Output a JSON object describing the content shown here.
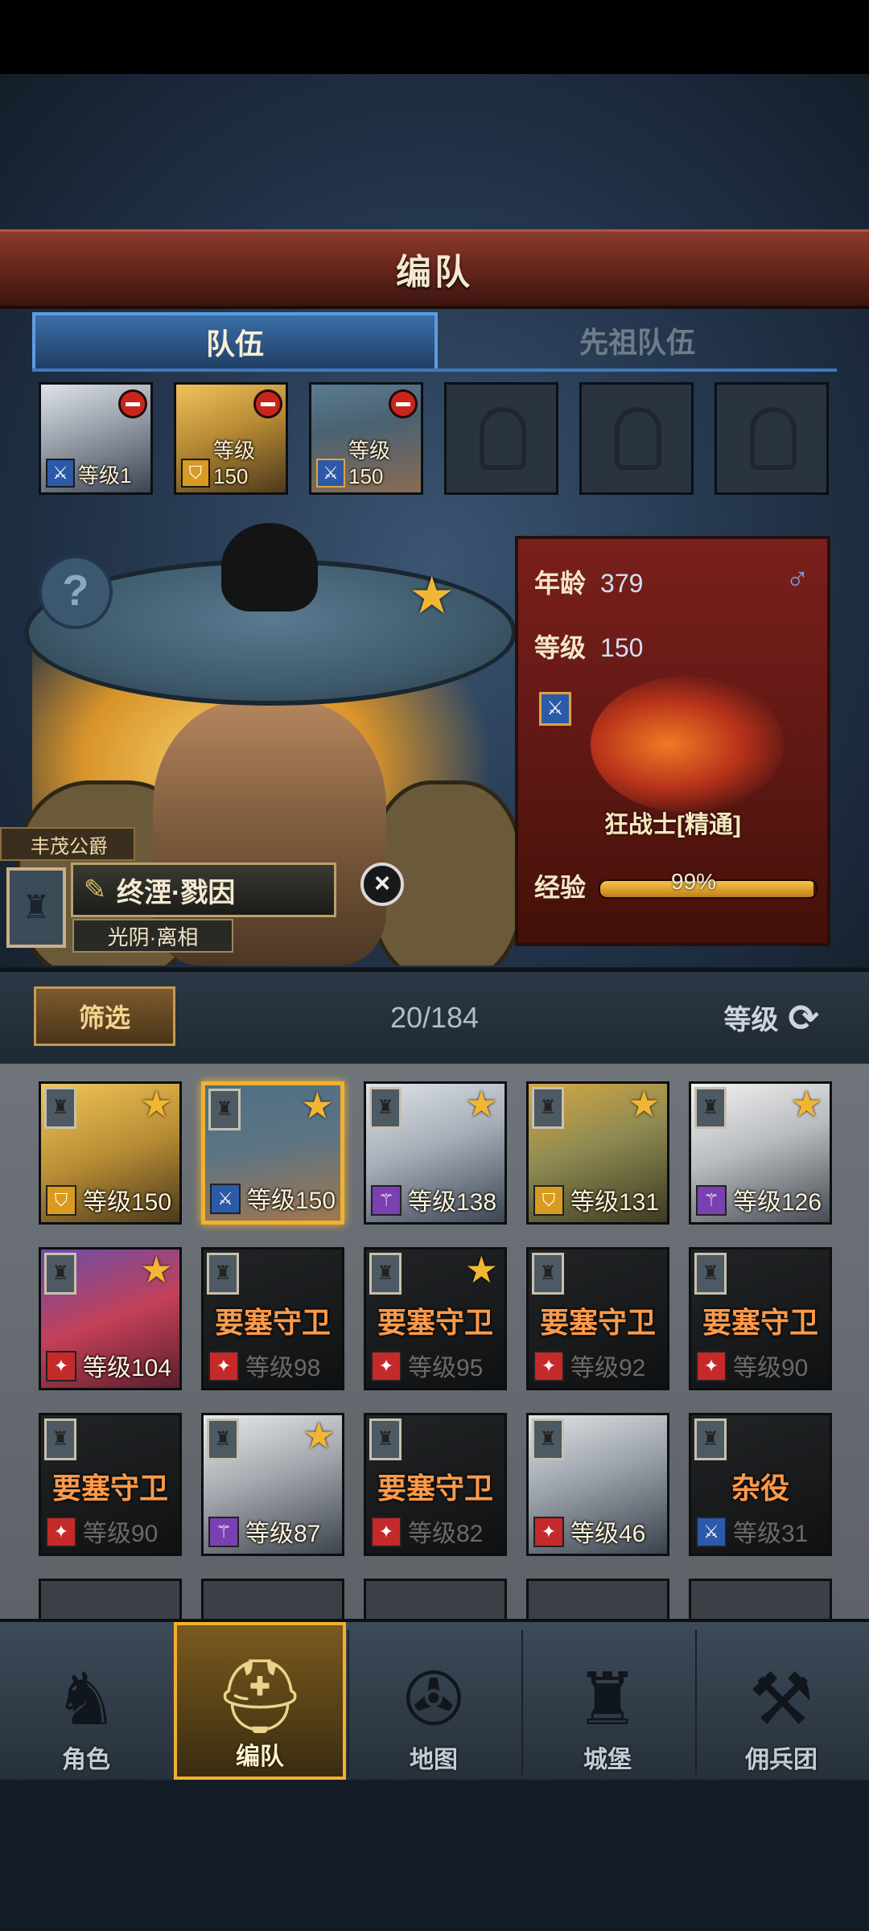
{
  "header": {
    "title": "编队"
  },
  "tabs": [
    {
      "label": "队伍",
      "active": true
    },
    {
      "label": "先祖队伍",
      "active": false
    }
  ],
  "team_slots": [
    {
      "level": "等级1",
      "class_icon": "sword-icon",
      "portrait": "elf-woman"
    },
    {
      "level": "等级150",
      "class_icon": "shield-icon",
      "portrait": "blonde-woman"
    },
    {
      "level": "等级150",
      "class_icon": "sword-star-icon",
      "portrait": "straw-hat-warrior"
    },
    {
      "empty": true
    },
    {
      "empty": true
    },
    {
      "empty": true
    }
  ],
  "hero": {
    "title": "丰茂公爵",
    "name": "终湮·戮因",
    "house": "光阴·离相",
    "age_label": "年龄",
    "age": "379",
    "level_label": "等级",
    "level": "150",
    "gender_icon": "male-icon",
    "class_name": "狂战士[精通]",
    "exp_label": "经验",
    "exp": "99%",
    "exp_fraction": 0.99
  },
  "filter": {
    "button": "筛选",
    "count": "20/184",
    "sort_label": "等级"
  },
  "roster": [
    {
      "level": "等级150",
      "class": "shield",
      "art": "blonde-woman",
      "star": true
    },
    {
      "level": "等级150",
      "class": "sword",
      "art": "straw-hat-warrior",
      "star": true,
      "selected": true
    },
    {
      "level": "等级138",
      "class": "staff",
      "art": "elf-woman",
      "star": true
    },
    {
      "level": "等级131",
      "class": "shield",
      "art": "bearded-warrior",
      "star": true
    },
    {
      "level": "等级126",
      "class": "staff",
      "art": "white-hair-elder",
      "star": true
    },
    {
      "level": "等级104",
      "class": "beast",
      "art": "bird-creature",
      "star": true
    },
    {
      "level": "等级98",
      "class": "beast",
      "role": "要塞守卫",
      "dim": true
    },
    {
      "level": "等级95",
      "class": "beast",
      "role": "要塞守卫",
      "dim": true,
      "star": true
    },
    {
      "level": "等级92",
      "class": "beast",
      "role": "要塞守卫",
      "dim": true
    },
    {
      "level": "等级90",
      "class": "beast",
      "role": "要塞守卫",
      "dim": true
    },
    {
      "level": "等级90",
      "class": "beast",
      "role": "要塞守卫",
      "dim": true
    },
    {
      "level": "等级87",
      "class": "staff",
      "art": "elf-elder",
      "star": true
    },
    {
      "level": "等级82",
      "class": "beast",
      "role": "要塞守卫",
      "dim": true
    },
    {
      "level": "等级46",
      "class": "beast",
      "art": "elf-man"
    },
    {
      "level": "等级31",
      "class": "sword",
      "role": "杂役",
      "dim": true
    }
  ],
  "nav": [
    {
      "label": "角色",
      "icon": "knight-icon"
    },
    {
      "label": "编队",
      "icon": "helmet-icon",
      "active": true
    },
    {
      "label": "地图",
      "icon": "compass-icon"
    },
    {
      "label": "城堡",
      "icon": "castle-icon"
    },
    {
      "label": "佣兵团",
      "icon": "mercenary-icon"
    }
  ]
}
